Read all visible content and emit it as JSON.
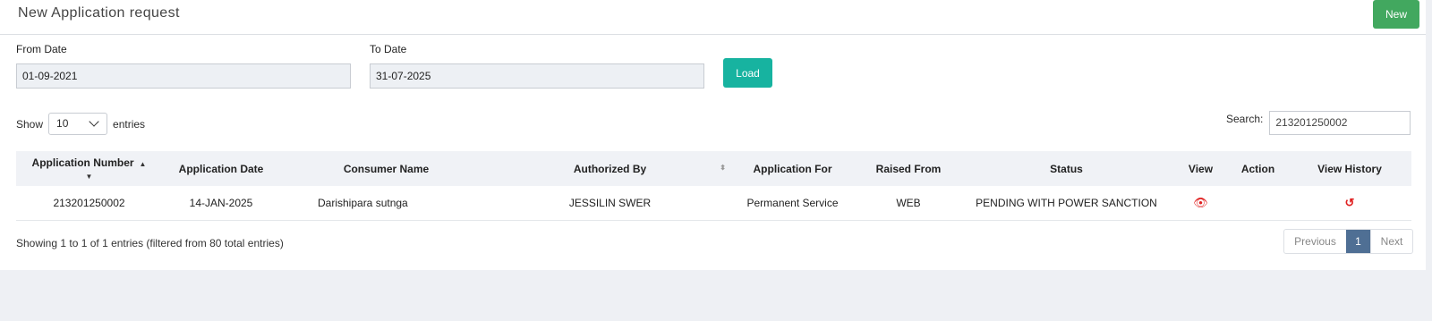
{
  "header": {
    "title": "New Application request",
    "new_label": "New"
  },
  "filters": {
    "from_label": "From Date",
    "from_value": "01-09-2021",
    "to_label": "To Date",
    "to_value": "31-07-2025",
    "load_label": "Load"
  },
  "length": {
    "show_label": "Show",
    "value": "10",
    "entries_label": "entries"
  },
  "search": {
    "label": "Search:",
    "value": "213201250002"
  },
  "table": {
    "columns": [
      "Application Number",
      "Application Date",
      "Consumer Name",
      "Authorized By",
      "Application For",
      "Raised From",
      "Status",
      "View",
      "Action",
      "View History"
    ],
    "rows": [
      {
        "app_number": "213201250002",
        "app_date": "14-JAN-2025",
        "consumer": "Darishipara sutnga",
        "authorized_by": "JESSILIN SWER",
        "app_for": "Permanent Service",
        "raised_from": "WEB",
        "status": "PENDING WITH POWER SANCTION",
        "view_icon": "eye-icon",
        "history_icon": "history-icon"
      }
    ]
  },
  "info": "Showing 1 to 1 of 1 entries (filtered from 80 total entries)",
  "pagination": {
    "previous": "Previous",
    "current": "1",
    "next": "Next"
  },
  "colors": {
    "new_button": "#42a85f",
    "load_button": "#17b3a0",
    "active_page": "#4f6f94",
    "icon_red": "#e02020"
  }
}
